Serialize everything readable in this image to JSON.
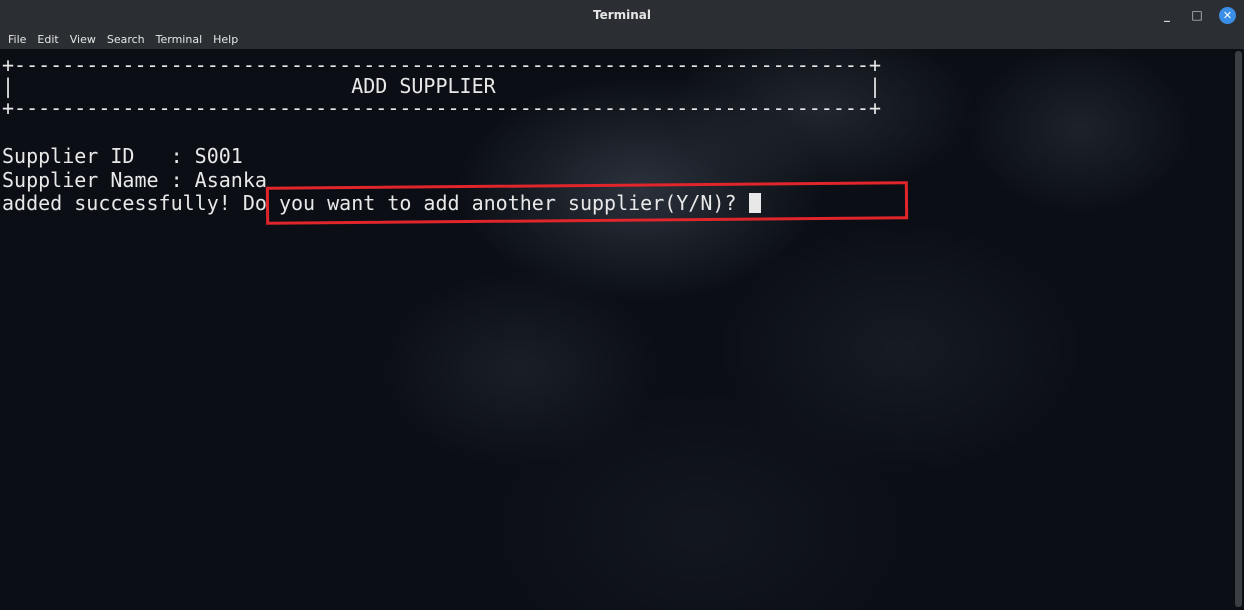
{
  "window": {
    "title": "Terminal",
    "controls": {
      "minimize_label": "_",
      "maximize_label": "□",
      "close_label": "✕"
    }
  },
  "menubar": {
    "items": [
      "File",
      "Edit",
      "View",
      "Search",
      "Terminal",
      "Help"
    ]
  },
  "terminal": {
    "lines": [
      "+-----------------------------------------------------------------------+",
      "|                            ADD SUPPLIER                               |",
      "+-----------------------------------------------------------------------+",
      "",
      "Supplier ID   : S001",
      "Supplier Name : Asanka",
      "added successfully! Do you want to add another supplier(Y/N)? "
    ]
  },
  "colors": {
    "titlebar": "#2b2f33",
    "terminal_text": "#e8e8e8",
    "highlight": "#e0252b",
    "close_button": "#3b8ee6"
  }
}
